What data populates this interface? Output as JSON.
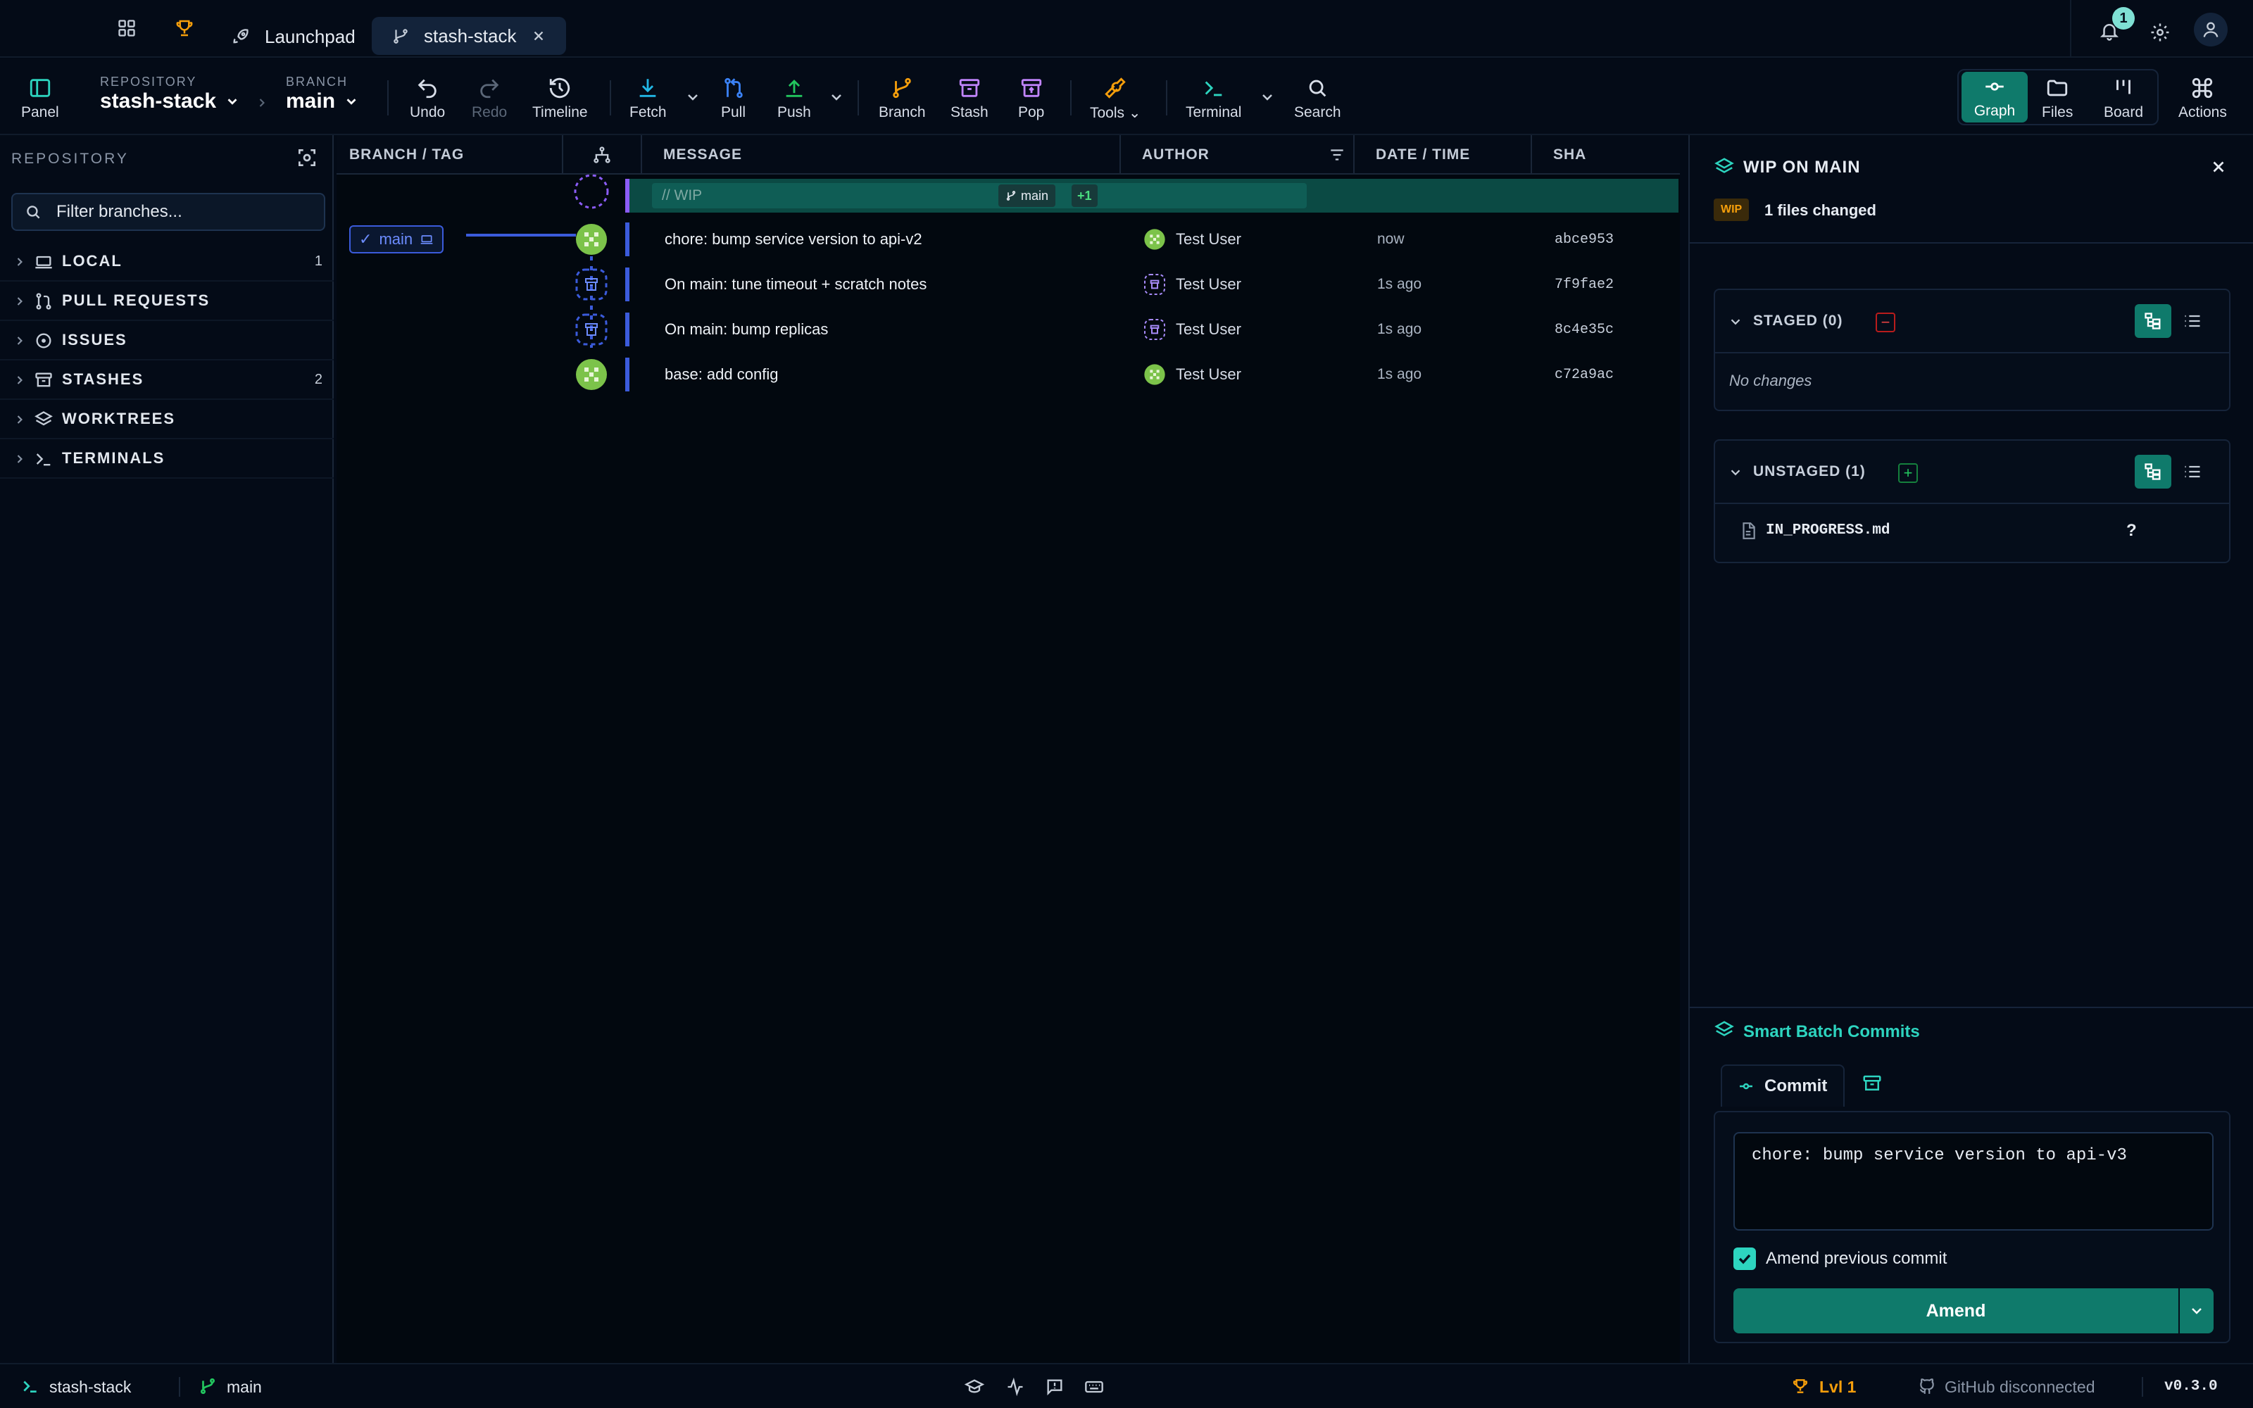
{
  "titlebar": {
    "tabs": [
      {
        "label": "Launchpad",
        "icon": "rocket-icon"
      },
      {
        "label": "stash-stack",
        "icon": "branch-icon"
      }
    ],
    "notification_count": "1"
  },
  "toolbar": {
    "panel": "Panel",
    "repository_label": "REPOSITORY",
    "repository_value": "stash-stack",
    "branch_label": "BRANCH",
    "branch_value": "main",
    "undo": "Undo",
    "redo": "Redo",
    "timeline": "Timeline",
    "fetch": "Fetch",
    "pull": "Pull",
    "push": "Push",
    "branch": "Branch",
    "stash": "Stash",
    "pop": "Pop",
    "tools": "Tools",
    "terminal": "Terminal",
    "search": "Search",
    "graph": "Graph",
    "files": "Files",
    "board": "Board",
    "actions": "Actions"
  },
  "sidebar": {
    "title": "REPOSITORY",
    "filter_placeholder": "Filter branches...",
    "sections": [
      {
        "label": "LOCAL",
        "count": "1",
        "icon": "laptop-icon"
      },
      {
        "label": "PULL REQUESTS",
        "count": "",
        "icon": "pull-request-icon"
      },
      {
        "label": "ISSUES",
        "count": "",
        "icon": "issue-icon"
      },
      {
        "label": "STASHES",
        "count": "2",
        "icon": "stash-box-icon"
      },
      {
        "label": "WORKTREES",
        "count": "",
        "icon": "layers-icon"
      },
      {
        "label": "TERMINALS",
        "count": "",
        "icon": "terminal-icon"
      }
    ]
  },
  "graph": {
    "headers": {
      "branch": "BRANCH / TAG",
      "message": "MESSAGE",
      "author": "AUTHOR",
      "date": "DATE / TIME",
      "sha": "SHA"
    },
    "wip": {
      "placeholder": "// WIP",
      "branch": "main",
      "extra": "+1"
    },
    "branch_tag": "main",
    "rows": [
      {
        "message": "chore: bump service version to api-v2",
        "author": "Test User",
        "date": "now",
        "sha": "abce953",
        "kind": "commit"
      },
      {
        "message": "On main: tune timeout + scratch notes",
        "author": "Test User",
        "date": "1s ago",
        "sha": "7f9fae2",
        "kind": "stash"
      },
      {
        "message": "On main: bump replicas",
        "author": "Test User",
        "date": "1s ago",
        "sha": "8c4e35c",
        "kind": "stash"
      },
      {
        "message": "base: add config",
        "author": "Test User",
        "date": "1s ago",
        "sha": "c72a9ac",
        "kind": "commit"
      }
    ]
  },
  "panel": {
    "title": "WIP ON MAIN",
    "badge": "WIP",
    "files_changed": "1 files changed",
    "staged_label": "STAGED (0)",
    "staged_empty": "No changes",
    "unstaged_label": "UNSTAGED (1)",
    "unstaged_files": [
      {
        "name": "IN_PROGRESS.md",
        "status": "?"
      }
    ],
    "smart_batch": "Smart Batch Commits",
    "commit_tab": "Commit",
    "commit_message": "chore: bump service version to api-v3",
    "amend_label": "Amend previous commit",
    "amend_checked": true,
    "amend_button": "Amend"
  },
  "status": {
    "repo": "stash-stack",
    "branch": "main",
    "level": "Lvl 1",
    "github": "GitHub disconnected",
    "version": "v0.3.0"
  },
  "colors": {
    "accent": "#0f7a6b",
    "accent_text": "#2dd4bf",
    "stash": "#a78bfa",
    "branch_line": "#3b5bdb",
    "orange": "#f59e0b"
  }
}
